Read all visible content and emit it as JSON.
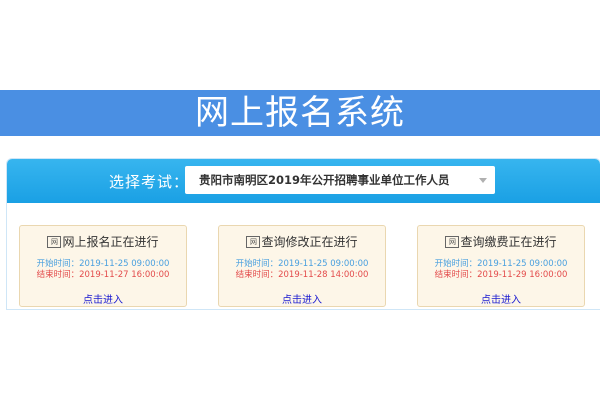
{
  "header": {
    "title": "网上报名系统"
  },
  "selector": {
    "label": "选择考试：",
    "selected_exam": "贵阳市南明区2019年公开招聘事业单位工作人员"
  },
  "cards": [
    {
      "icon": "web-icon",
      "icon_text": "网",
      "title": "网上报名正在进行",
      "start_label": "开始时间：",
      "start_time": "2019-11-25 09:00:00",
      "end_label": "结束时间：",
      "end_time": "2019-11-27 16:00:00",
      "link": "点击进入"
    },
    {
      "icon": "web-icon",
      "icon_text": "网",
      "title": "查询修改正在进行",
      "start_label": "开始时间：",
      "start_time": "2019-11-25 09:00:00",
      "end_label": "结束时间：",
      "end_time": "2019-11-28 14:00:00",
      "link": "点击进入"
    },
    {
      "icon": "web-icon",
      "icon_text": "网",
      "title": "查询缴费正在进行",
      "start_label": "开始时间：",
      "start_time": "2019-11-25 09:00:00",
      "end_label": "结束时间：",
      "end_time": "2019-11-29 16:00:00",
      "link": "点击进入"
    }
  ],
  "colors": {
    "banner": "#4a8fe3",
    "selector_bar": "#1aa0e4",
    "card_bg": "#fdf6e8",
    "start_time": "#4aa0df",
    "end_time": "#e34b4b",
    "link": "#1a1ad0"
  }
}
